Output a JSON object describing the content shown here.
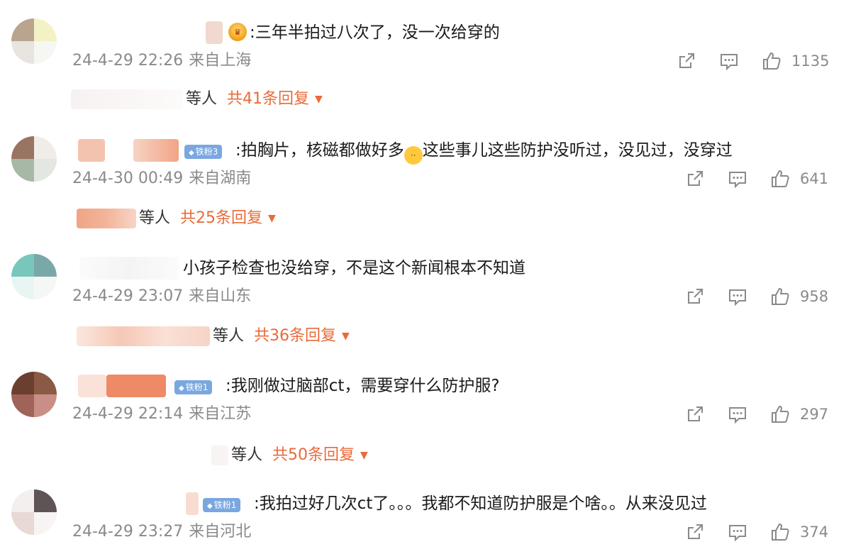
{
  "comments": [
    {
      "text": ":三年半拍过八次了，没一次给穿的",
      "date": "24-4-29 22:26",
      "location": "来自上海",
      "likes": "1135",
      "reply_others": "等人",
      "reply_total": "共41条回复"
    },
    {
      "badge": "铁粉3",
      "text_before": ":拍胸片，核磁都做好多",
      "text_after": "这些事儿这些防护没听过，没见过，没穿过",
      "date": "24-4-30 00:49",
      "location": "来自湖南",
      "likes": "641",
      "reply_others": "等人",
      "reply_total": "共25条回复"
    },
    {
      "text": "小孩子检查也没给穿，不是这个新闻根本不知道",
      "date": "24-4-29 23:07",
      "location": "来自山东",
      "likes": "958",
      "reply_others": "等人",
      "reply_total": "共36条回复"
    },
    {
      "badge": "铁粉1",
      "text": ":我刚做过脑部ct，需要穿什么防护服?",
      "date": "24-4-29 22:14",
      "location": "来自江苏",
      "likes": "297",
      "reply_others": "等人",
      "reply_total": "共50条回复"
    },
    {
      "badge": "铁粉1",
      "text": ":我拍过好几次ct了。。。我都不知道防护服是个啥。。从来没见过",
      "date": "24-4-29 23:27",
      "location": "来自河北",
      "likes": "374"
    }
  ],
  "icons": {
    "share": "share-icon",
    "comment": "comment-icon",
    "like": "like-icon",
    "expand": "caret-down-icon",
    "fan_badge": "diamond-icon",
    "vip": "crown-icon",
    "emoji": "emoji-icon"
  },
  "colors": {
    "accent": "#e86b3a",
    "meta_text": "#8a8a8a",
    "badge_bg": "#7aa7e0"
  }
}
